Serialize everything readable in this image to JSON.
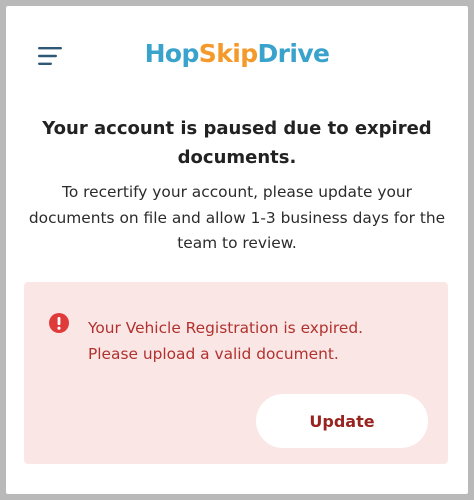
{
  "header": {
    "logo": {
      "part1": "Hop",
      "part2": "Skip",
      "part3": "Drive"
    },
    "menu_icon": "hamburger-menu-icon"
  },
  "main": {
    "title": "Your account is paused due to expired documents.",
    "description": "To recertify your account, please update your documents on file and allow 1-3 business days for the team to review."
  },
  "alert": {
    "icon": "alert-circle-icon",
    "line1": "Your Vehicle Registration is expired.",
    "line2": "Please upload a valid document.",
    "button_label": "Update"
  },
  "colors": {
    "logo_blue": "#3aa3cc",
    "logo_orange": "#f39a2a",
    "alert_bg": "#fbe6e6",
    "alert_text": "#b0322e",
    "alert_icon": "#e03b3b",
    "button_text": "#98231f"
  }
}
